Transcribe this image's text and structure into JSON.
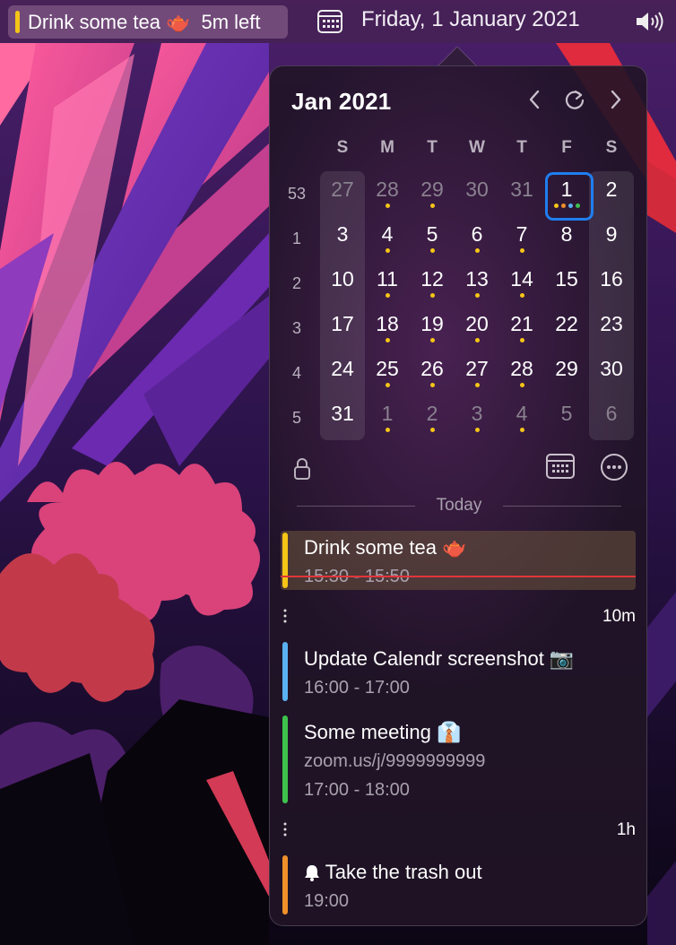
{
  "menubar": {
    "event_title": "Drink some tea 🫖",
    "event_remaining": "5m left",
    "date": "Friday, 1 January 2021",
    "event_color": "#f5c518"
  },
  "calendar": {
    "month_title": "Jan 2021",
    "weekdays": [
      "S",
      "M",
      "T",
      "W",
      "T",
      "F",
      "S"
    ],
    "week_numbers": [
      "53",
      "1",
      "2",
      "3",
      "4",
      "5"
    ],
    "weeks": [
      [
        {
          "d": "27",
          "m": true,
          "dots": []
        },
        {
          "d": "28",
          "m": true,
          "dots": [
            "#f5c518"
          ]
        },
        {
          "d": "29",
          "m": true,
          "dots": [
            "#f5c518"
          ]
        },
        {
          "d": "30",
          "m": true,
          "dots": []
        },
        {
          "d": "31",
          "m": true,
          "dots": []
        },
        {
          "d": "1",
          "m": false,
          "today": true,
          "dots": [
            "#f5c518",
            "#f0902a",
            "#5ab0f0",
            "#3ec24d"
          ]
        },
        {
          "d": "2",
          "m": false,
          "dots": []
        }
      ],
      [
        {
          "d": "3",
          "m": false,
          "dots": []
        },
        {
          "d": "4",
          "m": false,
          "dots": [
            "#f5c518"
          ]
        },
        {
          "d": "5",
          "m": false,
          "dots": [
            "#f5c518"
          ]
        },
        {
          "d": "6",
          "m": false,
          "dots": [
            "#f5c518"
          ]
        },
        {
          "d": "7",
          "m": false,
          "dots": [
            "#f5c518"
          ]
        },
        {
          "d": "8",
          "m": false,
          "dots": []
        },
        {
          "d": "9",
          "m": false,
          "dots": []
        }
      ],
      [
        {
          "d": "10",
          "m": false,
          "dots": []
        },
        {
          "d": "11",
          "m": false,
          "dots": [
            "#f5c518"
          ]
        },
        {
          "d": "12",
          "m": false,
          "dots": [
            "#f5c518"
          ]
        },
        {
          "d": "13",
          "m": false,
          "dots": [
            "#f5c518"
          ]
        },
        {
          "d": "14",
          "m": false,
          "dots": [
            "#f5c518"
          ]
        },
        {
          "d": "15",
          "m": false,
          "dots": []
        },
        {
          "d": "16",
          "m": false,
          "dots": []
        }
      ],
      [
        {
          "d": "17",
          "m": false,
          "dots": []
        },
        {
          "d": "18",
          "m": false,
          "dots": [
            "#f5c518"
          ]
        },
        {
          "d": "19",
          "m": false,
          "dots": [
            "#f5c518"
          ]
        },
        {
          "d": "20",
          "m": false,
          "dots": [
            "#f5c518"
          ]
        },
        {
          "d": "21",
          "m": false,
          "dots": [
            "#f5c518"
          ]
        },
        {
          "d": "22",
          "m": false,
          "dots": []
        },
        {
          "d": "23",
          "m": false,
          "dots": []
        }
      ],
      [
        {
          "d": "24",
          "m": false,
          "dots": []
        },
        {
          "d": "25",
          "m": false,
          "dots": [
            "#f5c518"
          ]
        },
        {
          "d": "26",
          "m": false,
          "dots": [
            "#f5c518"
          ]
        },
        {
          "d": "27",
          "m": false,
          "dots": [
            "#f5c518"
          ]
        },
        {
          "d": "28",
          "m": false,
          "dots": [
            "#f5c518"
          ]
        },
        {
          "d": "29",
          "m": false,
          "dots": []
        },
        {
          "d": "30",
          "m": false,
          "dots": []
        }
      ],
      [
        {
          "d": "31",
          "m": false,
          "dots": []
        },
        {
          "d": "1",
          "m": true,
          "dots": [
            "#f5c518"
          ]
        },
        {
          "d": "2",
          "m": true,
          "dots": [
            "#f5c518"
          ]
        },
        {
          "d": "3",
          "m": true,
          "dots": [
            "#f5c518"
          ]
        },
        {
          "d": "4",
          "m": true,
          "dots": [
            "#f5c518"
          ]
        },
        {
          "d": "5",
          "m": true,
          "dots": []
        },
        {
          "d": "6",
          "m": true,
          "dots": []
        }
      ]
    ]
  },
  "events_section": {
    "today_label": "Today",
    "events": [
      {
        "title": "Drink some tea 🫖",
        "time": "15:30 - 15:50",
        "color": "#f5c518"
      },
      {
        "title": "Update Calendr screenshot 📷",
        "time": "16:00 - 17:00",
        "color": "#5ab0f0"
      },
      {
        "title": "Some meeting 👔",
        "link": "zoom.us/j/9999999999",
        "time": "17:00 - 18:00",
        "color": "#3ec24d"
      },
      {
        "title": "Take the trash out",
        "time": "19:00",
        "color": "#f0902a"
      }
    ],
    "gaps": [
      "10m",
      "1h"
    ]
  },
  "colors": {
    "accent_today": "#1f7ef0",
    "now_line": "#e0353b"
  }
}
